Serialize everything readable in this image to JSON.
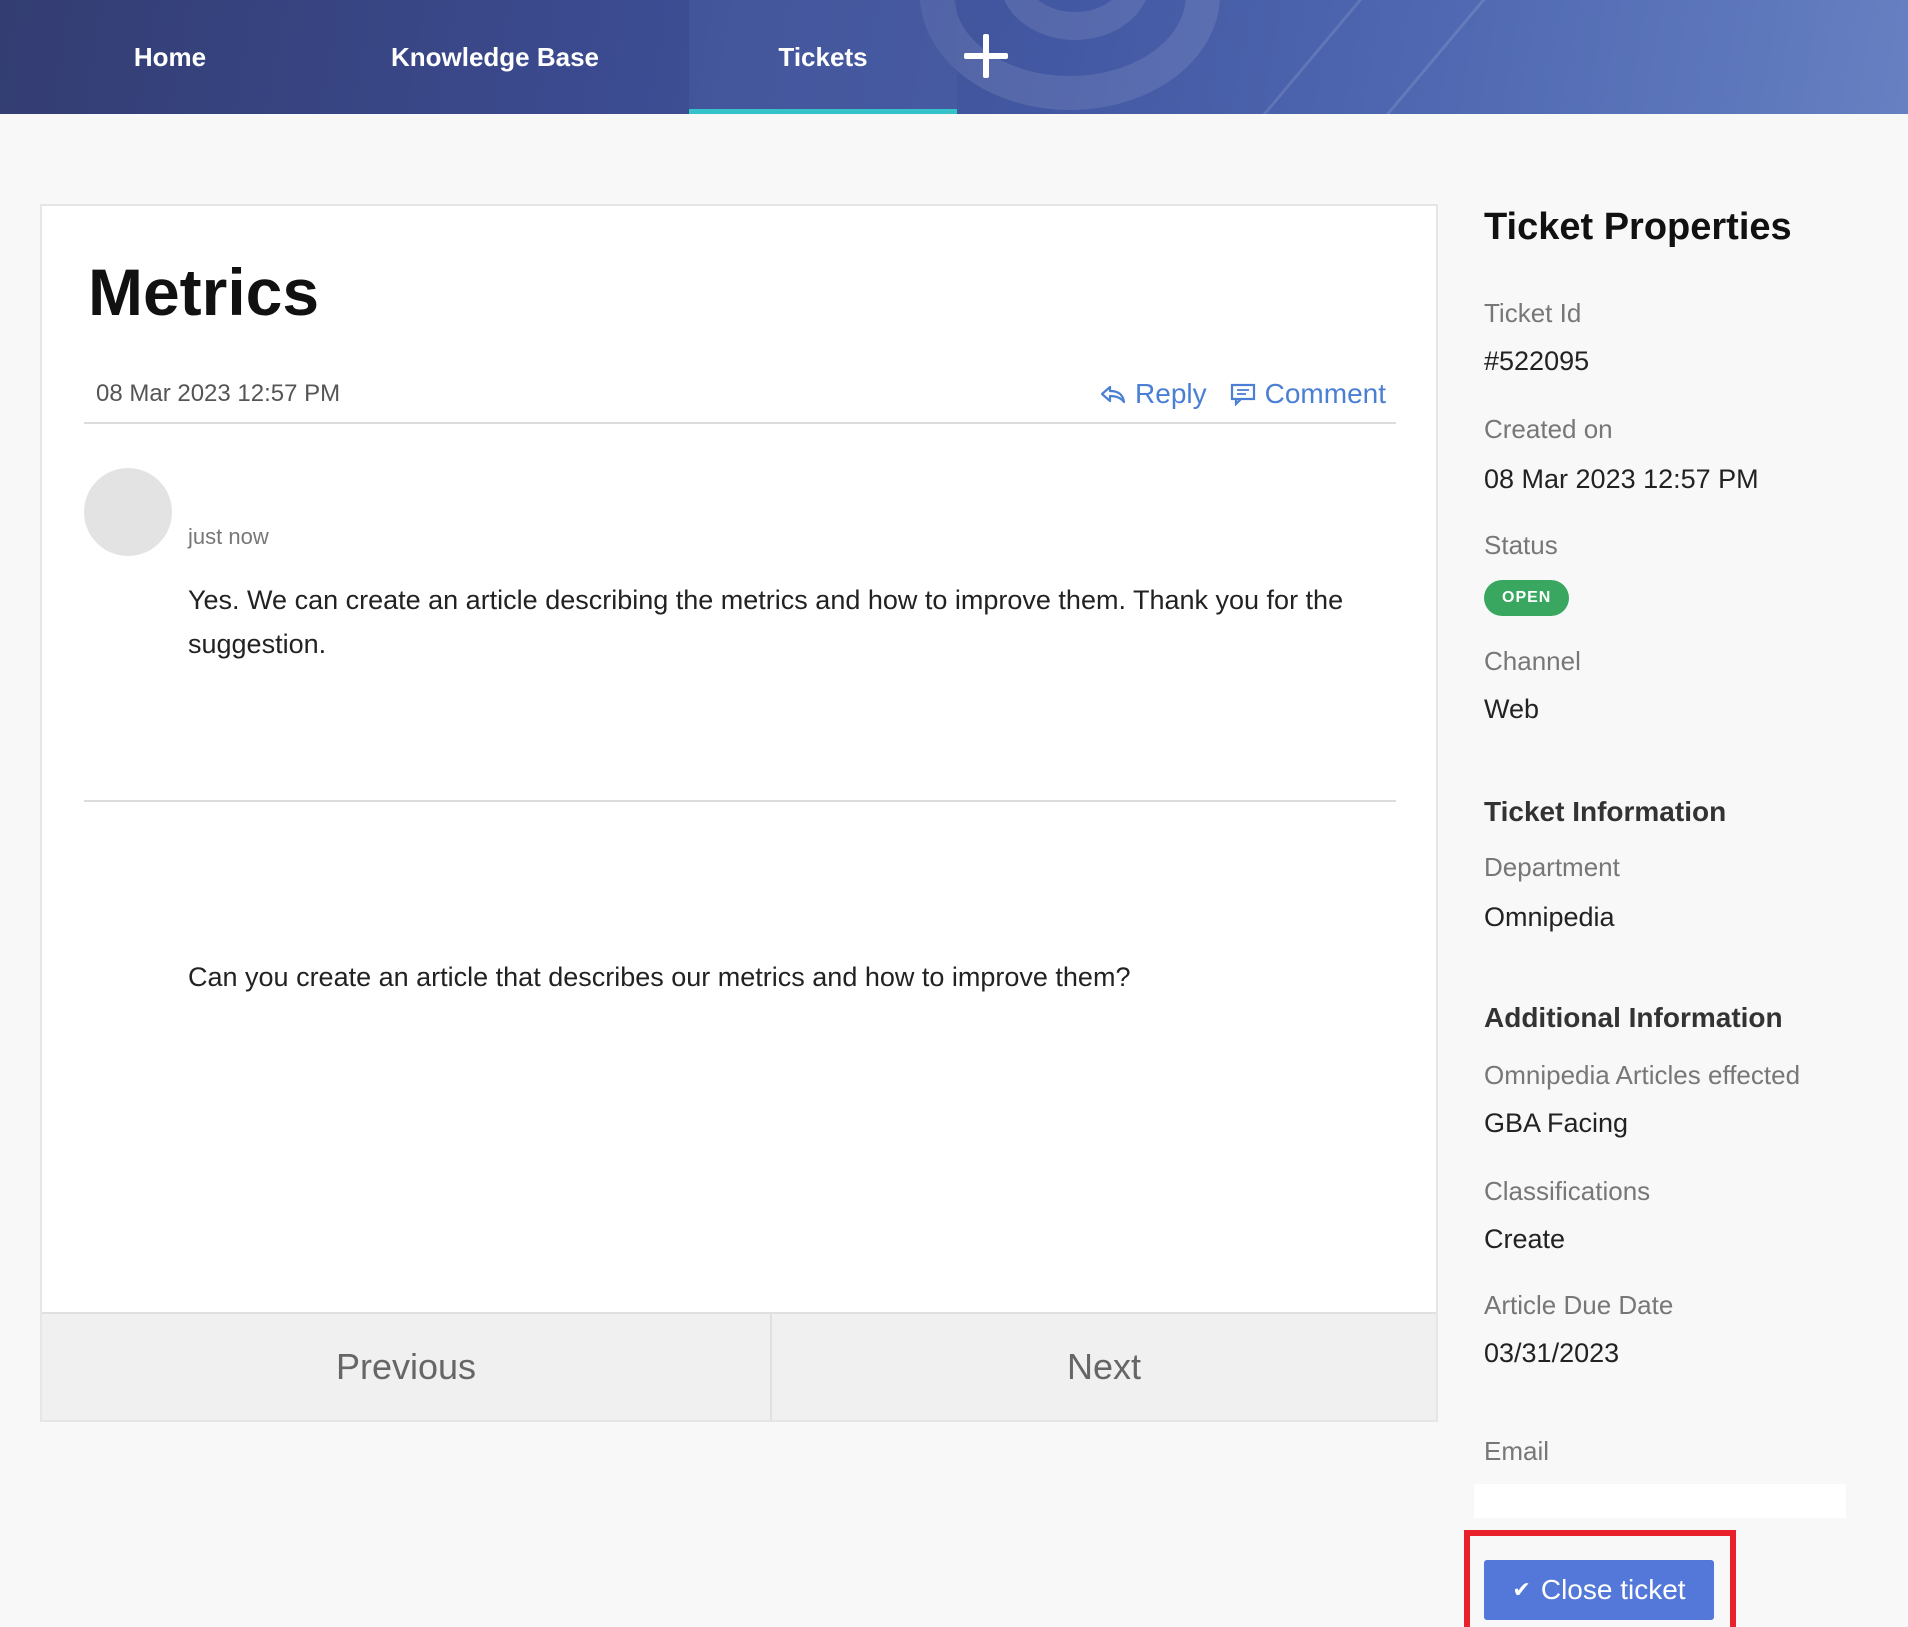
{
  "nav": {
    "home": "Home",
    "knowledge_base": "Knowledge Base",
    "tickets": "Tickets",
    "add_icon": "plus-icon"
  },
  "ticket": {
    "title": "Metrics",
    "date": "08 Mar 2023 12:57 PM",
    "reply_label": "Reply",
    "comment_label": "Comment",
    "message": {
      "time": "just now",
      "body": "Yes. We can create an article describing the metrics and how to improve them. Thank you for the suggestion."
    },
    "question": "Can you create an article that describes our metrics and how to improve them?",
    "previous_label": "Previous",
    "next_label": "Next"
  },
  "sidebar": {
    "heading": "Ticket Properties",
    "ticket_id_label": "Ticket Id",
    "ticket_id": "#522095",
    "created_label": "Created on",
    "created": "08 Mar 2023 12:57 PM",
    "status_label": "Status",
    "status": "OPEN",
    "channel_label": "Channel",
    "channel": "Web",
    "info_heading": "Ticket Information",
    "department_label": "Department",
    "department": "Omnipedia",
    "additional_heading": "Additional Information",
    "articles_label": "Omnipedia Articles effected",
    "articles": "GBA Facing",
    "classifications_label": "Classifications",
    "classifications": "Create",
    "due_label": "Article Due Date",
    "due": "03/31/2023",
    "email_label": "Email",
    "email_value": "",
    "close_label": "Close ticket"
  },
  "colors": {
    "accent": "#5478d9",
    "status_open": "#3aa760",
    "tab_underline": "#35c3c9",
    "highlight": "#e8212b"
  }
}
